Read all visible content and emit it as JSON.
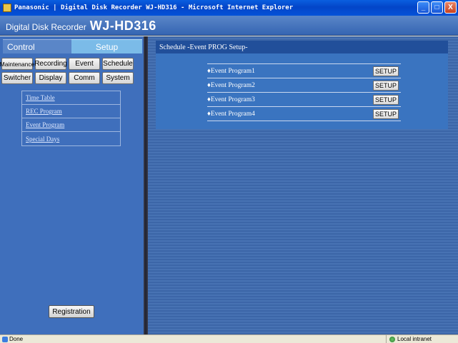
{
  "window": {
    "title": "Panasonic | Digital Disk Recorder WJ-HD316 - Microsoft Internet Explorer",
    "minimize": "_",
    "maximize": "□",
    "close": "X"
  },
  "header": {
    "brand": "Digital Disk Recorder",
    "model": "WJ-HD316"
  },
  "tabs": {
    "control": "Control",
    "setup": "Setup"
  },
  "menu": {
    "row1": [
      "Maintenance",
      "Recording",
      "Event",
      "Schedule"
    ],
    "row2": [
      "Switcher",
      "Display",
      "Comm",
      "System"
    ]
  },
  "submenu": [
    "Time Table",
    "REC Program",
    "Event Program",
    "Special Days"
  ],
  "registration_label": "Registration",
  "panel": {
    "title": "Schedule -Event PROG Setup-",
    "rows": [
      {
        "label": "♦Event Program1",
        "button": "SETUP"
      },
      {
        "label": "♦Event Program2",
        "button": "SETUP"
      },
      {
        "label": "♦Event Program3",
        "button": "SETUP"
      },
      {
        "label": "♦Event Program4",
        "button": "SETUP"
      }
    ]
  },
  "status": {
    "left": "Done",
    "zone": "Local intranet"
  }
}
